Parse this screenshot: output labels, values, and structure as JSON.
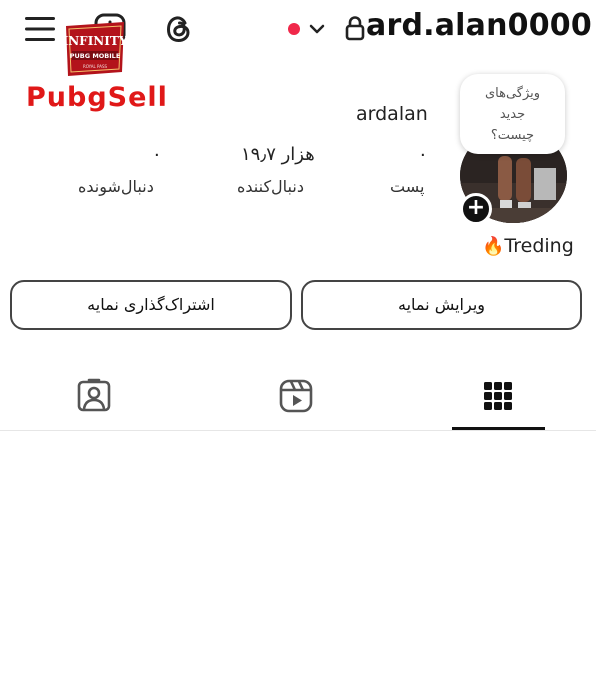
{
  "header": {
    "username": "ard.alan0000",
    "icons": {
      "menu": "menu-icon",
      "add": "add-icon",
      "threads": "threads-icon",
      "chevron": "chevron-down-icon",
      "lock": "lock-icon"
    },
    "online_dot_color": "#f0284a"
  },
  "watermark": {
    "badge_top": "INFINITY",
    "badge_bottom": "PUBG MOBILE",
    "badge_tiny": "ROYAL PASS",
    "text": "PubgSell",
    "color": "#e01818"
  },
  "profile": {
    "display_name": "ardalan",
    "stats": [
      {
        "value": "۰",
        "label": "پست"
      },
      {
        "value": "۱۹٫۷ هزار",
        "label": "دنبال‌کننده"
      },
      {
        "value": "۰",
        "label": "دنبال‌شونده"
      }
    ],
    "bubble": [
      "ویژگی‌های",
      "جدید",
      "چیست؟"
    ],
    "bio": {
      "emoji": "🔥",
      "text": "Treding"
    }
  },
  "buttons": {
    "edit_profile": "ویرایش نمایه",
    "share_profile": "اشتراک‌گذاری نمایه"
  },
  "tabs": [
    {
      "name": "grid",
      "icon": "grid-icon",
      "active": true
    },
    {
      "name": "reels",
      "icon": "reels-icon",
      "active": false
    },
    {
      "name": "tagged",
      "icon": "tagged-icon",
      "active": false
    }
  ]
}
